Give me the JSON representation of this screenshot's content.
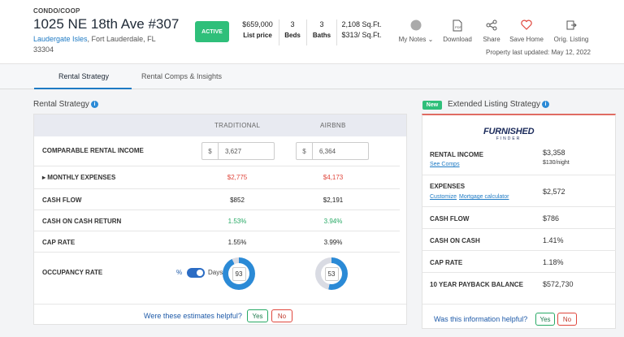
{
  "listing": {
    "type": "CONDO/COOP",
    "address": "1025 NE 18th Ave #307",
    "city_link": "Laudergate Isles",
    "city_rest": ", Fort Lauderdale, FL",
    "zip": "33304",
    "status": "ACTIVE",
    "price": "$659,000",
    "price_label": "List price",
    "beds": "3",
    "beds_label": "Beds",
    "baths": "3",
    "baths_label": "Baths",
    "sqft": "2,108 Sq.Ft.",
    "price_per_sqft": "$313/ Sq.Ft.",
    "updated": "Property last updated: May 12, 2022"
  },
  "actions": {
    "notes": "My Notes",
    "download": "Download",
    "share": "Share",
    "save": "Save Home",
    "orig": "Orig. Listing"
  },
  "tabs": [
    "Rental Strategy",
    "Rental Comps & Insights"
  ],
  "rental": {
    "title": "Rental Strategy",
    "col_traditional": "TRADITIONAL",
    "col_airbnb": "AIRBNB",
    "currency": "$",
    "rows": {
      "income_label": "COMPARABLE RENTAL INCOME",
      "income_trad": "3,627",
      "income_air": "6,364",
      "expenses_label": "MONTHLY EXPENSES",
      "expenses_trad": "$2,775",
      "expenses_air": "$4,173",
      "cashflow_label": "CASH FLOW",
      "cashflow_trad": "$852",
      "cashflow_air": "$2,191",
      "coc_label": "CASH ON CASH RETURN",
      "coc_trad": "1.53%",
      "coc_air": "3.94%",
      "cap_label": "CAP RATE",
      "cap_trad": "1.55%",
      "cap_air": "3.99%",
      "occ_label": "OCCUPANCY RATE",
      "occ_pct": "%",
      "occ_days": "Days",
      "occ_trad": "93",
      "occ_air": "53"
    },
    "helpful": "Were these estimates helpful?",
    "yes": "Yes",
    "no": "No"
  },
  "extended": {
    "new": "New",
    "title": "Extended Listing Strategy",
    "logo_main": "FURNISHED",
    "logo_sub": "FINDER",
    "income_label": "RENTAL INCOME",
    "income_value": "$3,358",
    "income_night": "$130/night",
    "see_comps": "See Comps",
    "expenses_label": "EXPENSES",
    "expenses_value": "$2,572",
    "customize": "Customize",
    "mortgage": "Mortgage calculator",
    "cashflow_label": "CASH FLOW",
    "cashflow_value": "$786",
    "coc_label": "CASH ON CASH",
    "coc_value": "1.41%",
    "cap_label": "CAP RATE",
    "cap_value": "1.18%",
    "payback_label": "10 YEAR PAYBACK BALANCE",
    "payback_value": "$572,730",
    "helpful": "Was this information helpful?",
    "yes": "Yes",
    "no": "No"
  },
  "colors": {
    "accent": "#1e7ac4",
    "active_green": "#2fbf7a",
    "red": "#e0463c",
    "donut": "#2b8ad6"
  }
}
